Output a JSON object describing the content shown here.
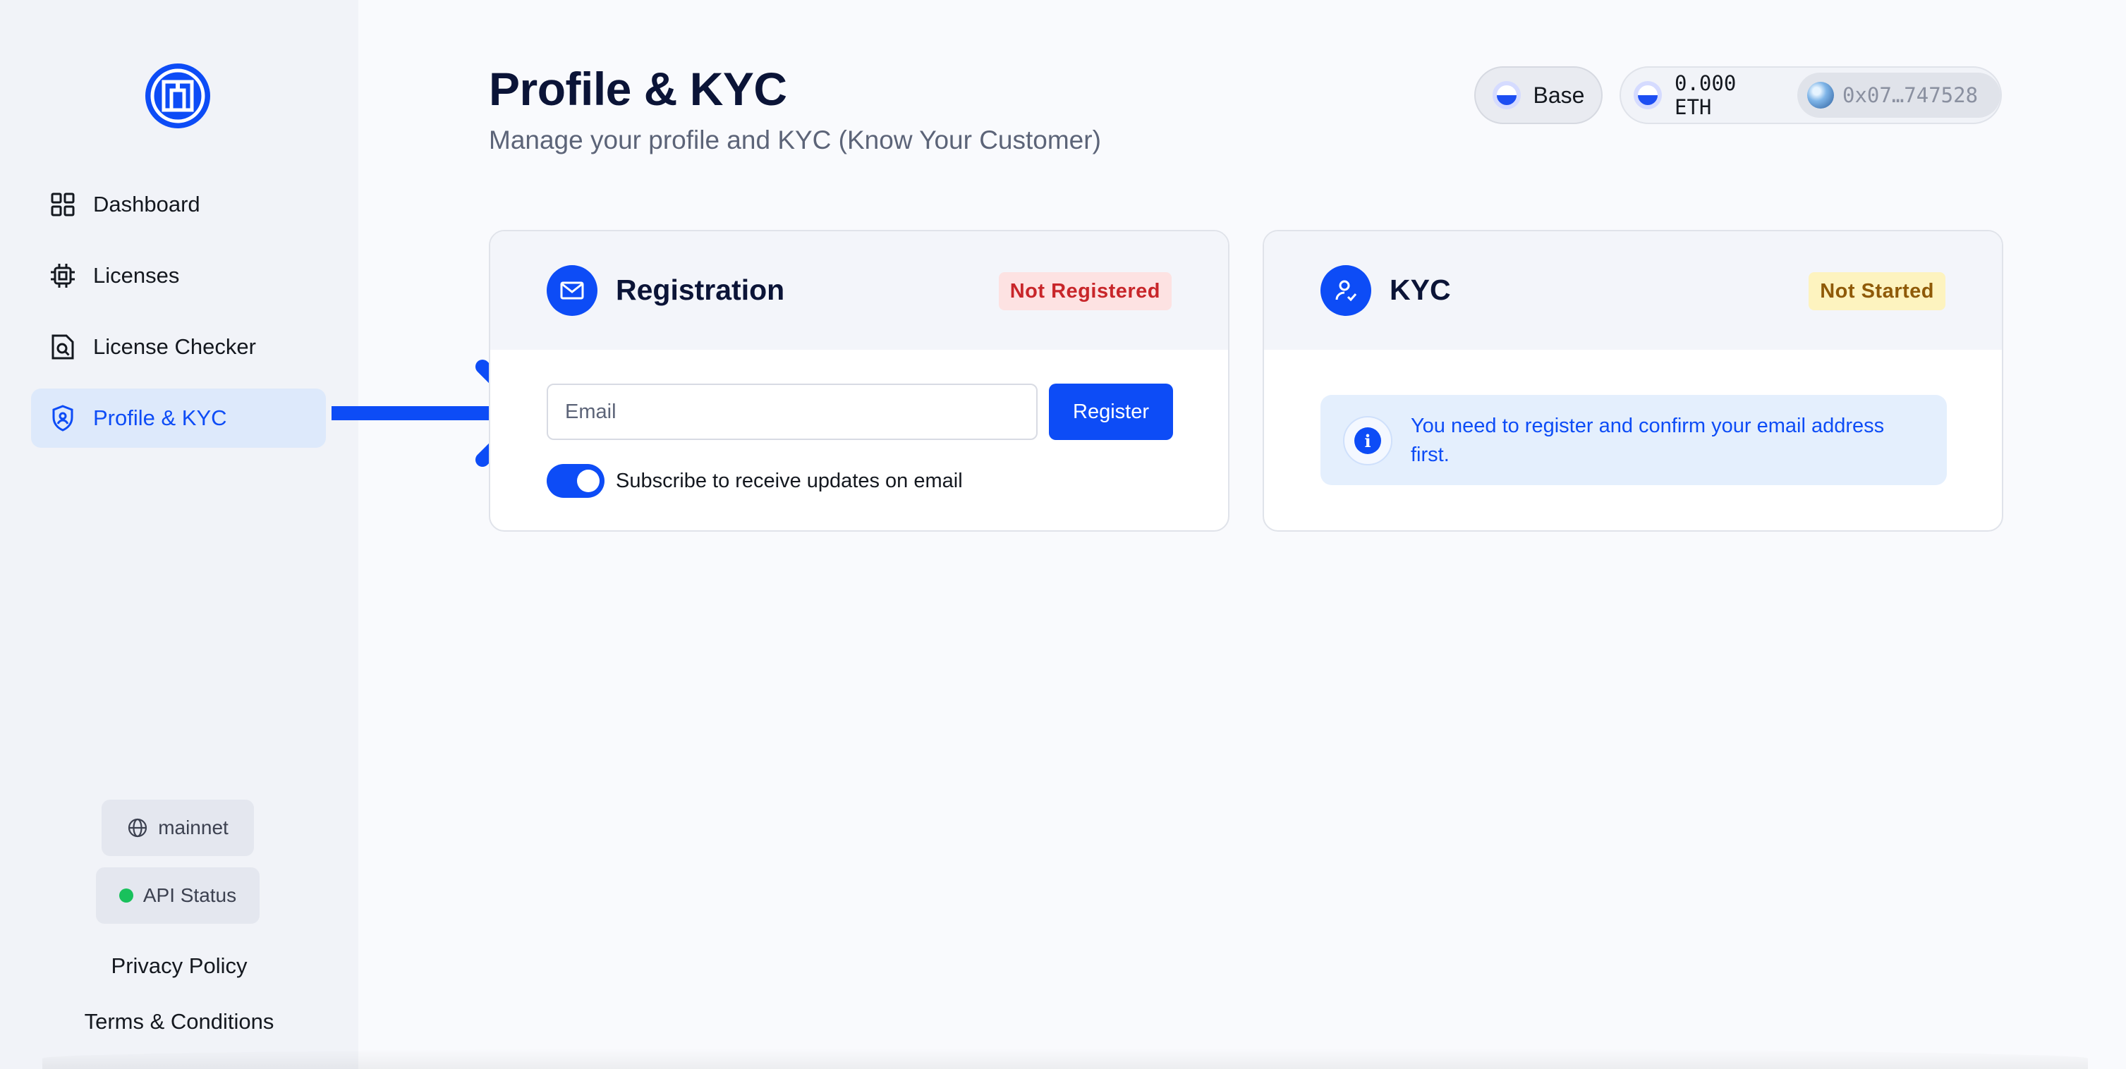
{
  "sidebar": {
    "items": [
      {
        "label": "Dashboard",
        "icon": "grid-icon"
      },
      {
        "label": "Licenses",
        "icon": "chip-icon"
      },
      {
        "label": "License Checker",
        "icon": "file-search-icon"
      },
      {
        "label": "Profile & KYC",
        "icon": "shield-user-icon",
        "active": true
      }
    ],
    "network_label": "mainnet",
    "api_status_label": "API Status",
    "api_status_color": "#19c15c",
    "privacy_label": "Privacy Policy",
    "terms_label": "Terms & Conditions"
  },
  "header": {
    "title": "Profile & KYC",
    "subtitle": "Manage your profile and KYC (Know Your Customer)",
    "network": "Base",
    "balance": "0.000 ETH",
    "address": "0x07…747528"
  },
  "registration": {
    "title": "Registration",
    "status": "Not Registered",
    "email_placeholder": "Email",
    "email_value": "",
    "register_label": "Register",
    "subscribe_label": "Subscribe to receive updates on email",
    "subscribe_on": true
  },
  "kyc": {
    "title": "KYC",
    "status": "Not Started",
    "info_message": "You need to register and confirm your email address first."
  },
  "colors": {
    "accent": "#0d4cf6",
    "danger_bg": "#fde2e2",
    "danger_text": "#c8262a",
    "warning_bg": "#fdf3bf",
    "warning_text": "#8f5a08",
    "info_bg": "#e4effd"
  }
}
